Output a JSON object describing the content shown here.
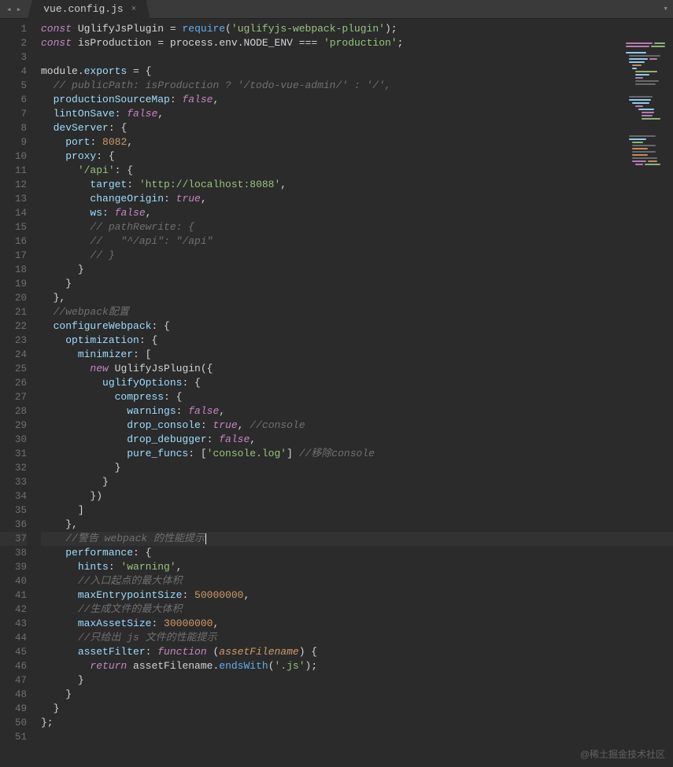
{
  "titlebar": {
    "nav_back": "◂",
    "nav_fwd": "▸",
    "tab_label": "vue.config.js",
    "tab_close": "×",
    "menu_caret": "▾"
  },
  "lines_count": 51,
  "highlight_line": 37,
  "code": {
    "l1": {
      "const": "const",
      "name": "UglifyJsPlugin",
      "eq": "=",
      "req": "require",
      "op": "(",
      "arg": "'uglifyjs-webpack-plugin'",
      "cp": ");"
    },
    "l2": {
      "const": "const",
      "name": "isProduction",
      "eq": "=",
      "obj": "process",
      "d1": ".",
      "env": "env",
      "d2": ".",
      "node": "NODE_ENV",
      "opq": "===",
      "str": "'production'",
      "end": ";"
    },
    "l4": {
      "mod": "module",
      "d": ".",
      "exp": "exports",
      "eq": "=",
      "ob": " {"
    },
    "l5": {
      "cmt": "// publicPath: isProduction ? '/todo-vue-admin/' : '/',"
    },
    "l6": {
      "key": "productionSourceMap",
      "c": ": ",
      "val": "false",
      "p": ","
    },
    "l7": {
      "key": "lintOnSave",
      "c": ": ",
      "val": "false",
      "p": ","
    },
    "l8": {
      "key": "devServer",
      "c": ": ",
      "ob": "{"
    },
    "l9": {
      "key": "port",
      "c": ": ",
      "val": "8082",
      "p": ","
    },
    "l10": {
      "key": "proxy",
      "c": ": ",
      "ob": "{"
    },
    "l11": {
      "key": "'/api'",
      "c": ": ",
      "ob": "{"
    },
    "l12": {
      "key": "target",
      "c": ": ",
      "val": "'http://localhost:8088'",
      "p": ","
    },
    "l13": {
      "key": "changeOrigin",
      "c": ": ",
      "val": "true",
      "p": ","
    },
    "l14": {
      "key": "ws",
      "c": ": ",
      "val": "false",
      "p": ","
    },
    "l15": {
      "cmt": "// pathRewrite: {"
    },
    "l16": {
      "cmt": "//   \"^/api\": \"/api\""
    },
    "l17": {
      "cmt": "// }"
    },
    "l18": {
      "cb": "}"
    },
    "l19": {
      "cb": "}"
    },
    "l20": {
      "cb": "},",
      "p": ""
    },
    "l21": {
      "cmt": "//webpack配置"
    },
    "l22": {
      "key": "configureWebpack",
      "c": ": ",
      "ob": "{"
    },
    "l23": {
      "key": "optimization",
      "c": ": ",
      "ob": "{"
    },
    "l24": {
      "key": "minimizer",
      "c": ": ",
      "ob": "["
    },
    "l25": {
      "new": "new",
      "cls": "UglifyJsPlugin",
      "ob": "({"
    },
    "l26": {
      "key": "uglifyOptions",
      "c": ": ",
      "ob": "{"
    },
    "l27": {
      "key": "compress",
      "c": ": ",
      "ob": "{"
    },
    "l28": {
      "key": "warnings",
      "c": ": ",
      "val": "false",
      "p": ","
    },
    "l29": {
      "key": "drop_console",
      "c": ": ",
      "val": "true",
      "p": ",",
      "cmt": " //console"
    },
    "l30": {
      "key": "drop_debugger",
      "c": ": ",
      "val": "false",
      "p": ","
    },
    "l31": {
      "key": "pure_funcs",
      "c": ": ",
      "ob": "[",
      "val": "'console.log'",
      "cb": "]",
      "cmt": " //移除console"
    },
    "l32": {
      "cb": "}"
    },
    "l33": {
      "cb": "}"
    },
    "l34": {
      "cb": "})"
    },
    "l35": {
      "cb": "]"
    },
    "l36": {
      "cb": "},"
    },
    "l37": {
      "cmt": "//警告 webpack 的性能提示"
    },
    "l38": {
      "key": "performance",
      "c": ": ",
      "ob": "{"
    },
    "l39": {
      "key": "hints",
      "c": ": ",
      "val": "'warning'",
      "p": ","
    },
    "l40": {
      "cmt": "//入口起点的最大体积"
    },
    "l41": {
      "key": "maxEntrypointSize",
      "c": ": ",
      "val": "50000000",
      "p": ","
    },
    "l42": {
      "cmt": "//生成文件的最大体积"
    },
    "l43": {
      "key": "maxAssetSize",
      "c": ": ",
      "val": "30000000",
      "p": ","
    },
    "l44": {
      "cmt": "//只给出 js 文件的性能提示"
    },
    "l45": {
      "key": "assetFilter",
      "c": ": ",
      "fn": "function",
      "op": " (",
      "param": "assetFilename",
      "cp": ") {"
    },
    "l46": {
      "ret": "return",
      "ident": "assetFilename",
      "d": ".",
      "meth": "endsWith",
      "op": "(",
      "arg": "'.js'",
      "cp": ");"
    },
    "l47": {
      "cb": "}"
    },
    "l48": {
      "cb": "}"
    },
    "l49": {
      "cb": "}"
    },
    "l50": {
      "cb": "};"
    }
  },
  "watermark": "@稀土掘金技术社区"
}
